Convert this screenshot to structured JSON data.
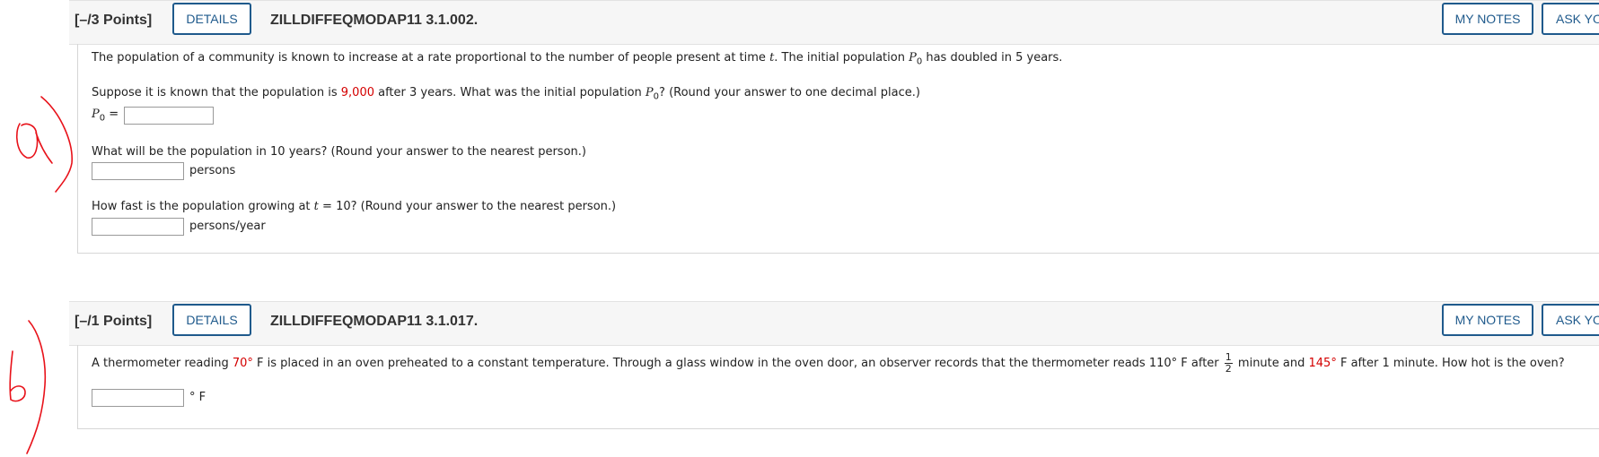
{
  "question1": {
    "points": "[–/3 Points]",
    "details_label": "DETAILS",
    "id": "ZILLDIFFEQMODAP11 3.1.002.",
    "my_notes_label": "MY NOTES",
    "ask_label": "ASK YO",
    "intro_a": "The population of a community is known to increase at a rate proportional to the number of people present at time ",
    "intro_t": "t",
    "intro_b": ". The initial population ",
    "intro_p": "P",
    "intro_sub": "0",
    "intro_c": " has doubled in 5 years.",
    "suppose_a": "Suppose it is known that the population is ",
    "suppose_value": "9,000",
    "suppose_b": " after 3 years. What was the initial population ",
    "suppose_p": "P",
    "suppose_sub": "0",
    "suppose_c": "? (Round your answer to one decimal place.)",
    "p0_label": "P",
    "p0_sub": "0",
    "p0_eq": " =",
    "p0_value": "",
    "q2_text": "What will be the population in 10 years? (Round your answer to the nearest person.)",
    "q2_value": "",
    "q2_unit": "persons",
    "q3_a": "How fast is the population growing at ",
    "q3_t": "t",
    "q3_b": " = 10? (Round your answer to the nearest person.)",
    "q3_value": "",
    "q3_unit": "persons/year"
  },
  "question2": {
    "points": "[–/1 Points]",
    "details_label": "DETAILS",
    "id": "ZILLDIFFEQMODAP11 3.1.017.",
    "my_notes_label": "MY NOTES",
    "ask_label": "ASK YO",
    "text_a": "A thermometer reading ",
    "temp1": "70°",
    "text_b": " F is placed in an oven preheated to a constant temperature. Through a glass window in the oven door, an observer records that the thermometer reads 110° F after ",
    "frac_num": "1",
    "frac_den": "2",
    "text_c": " minute and ",
    "temp2": "145°",
    "text_d": " F after 1 minute. How hot is the oven?",
    "answer_value": "",
    "answer_unit": "° F"
  },
  "annotations": {
    "ink_color": "#e8121a"
  }
}
